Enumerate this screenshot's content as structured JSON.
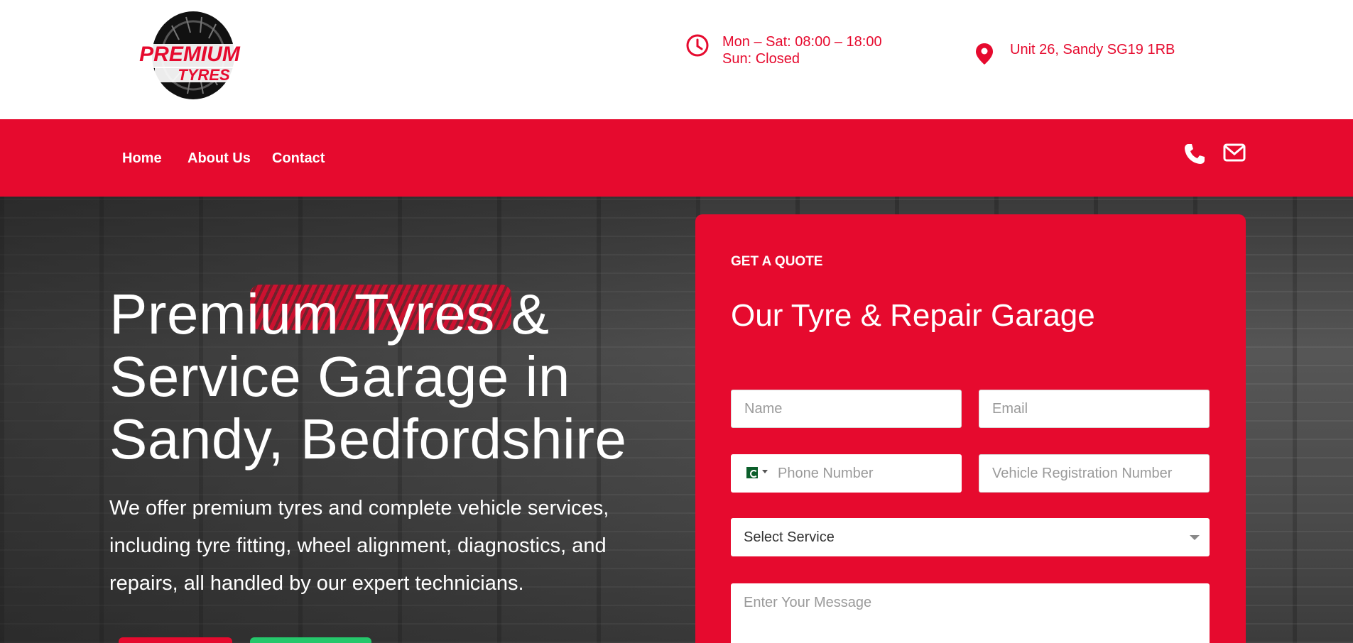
{
  "brand": {
    "logo_line1": "PREMIUM",
    "logo_line2": "TYRES",
    "accent": "#e60a2e"
  },
  "header": {
    "hours_line1": "Mon – Sat: 08:00 – 18:00",
    "hours_line2": "Sun: Closed",
    "address": "Unit 26, Sandy SG19 1RB",
    "hours_icon": "clock-icon",
    "address_icon": "map-pin-icon"
  },
  "nav": {
    "links": [
      {
        "label": "Home"
      },
      {
        "label": "About Us"
      },
      {
        "label": "Contact"
      }
    ],
    "icons": [
      "phone-icon",
      "mail-icon"
    ]
  },
  "hero": {
    "title": "Premium Tyres & Service Garage in Sandy, Bedfordshire",
    "lead": "We offer premium tyres and complete vehicle services, including tyre fitting, wheel alignment, diagnostics, and repairs, all handled by our expert technicians."
  },
  "quote": {
    "eyebrow": "GET A QUOTE",
    "heading": "Our Tyre & Repair Garage",
    "name_placeholder": "Name",
    "email_placeholder": "Email",
    "phone_placeholder": "Phone Number",
    "reg_placeholder": "Vehicle Registration Number",
    "service_selected": "Select Service",
    "message_placeholder": "Enter Your Message"
  }
}
